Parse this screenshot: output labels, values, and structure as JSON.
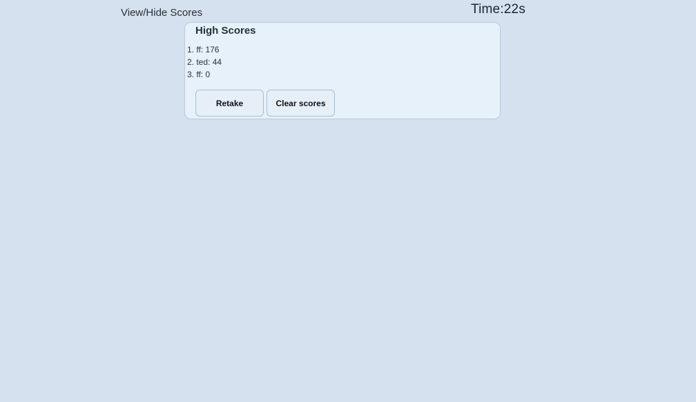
{
  "header": {
    "toggle_label": "View/Hide Scores",
    "timer_text": "Time:22s"
  },
  "scores": {
    "title": "High Scores",
    "entries": [
      {
        "text": "1. ff: 176"
      },
      {
        "text": "2. ted: 44"
      },
      {
        "text": "3. ff: 0"
      }
    ],
    "retake_label": "Retake",
    "clear_label": "Clear scores"
  },
  "colors": {
    "background": "#d5e1ee",
    "card": "#e7f1fa",
    "border": "#b9c8d8"
  }
}
